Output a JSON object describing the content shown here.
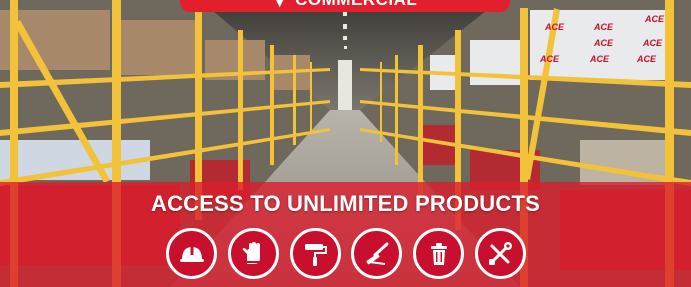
{
  "banner": {
    "text": "COMMERCIAL"
  },
  "headline": "ACCESS TO UNLIMITED PRODUCTS",
  "brand_marks": [
    "ACE",
    "ACE",
    "ACE",
    "ACE",
    "ACE",
    "ACE",
    "ACE",
    "ACE"
  ],
  "categories": [
    {
      "icon": "hard-hat-icon"
    },
    {
      "icon": "work-glove-icon"
    },
    {
      "icon": "paint-roller-icon"
    },
    {
      "icon": "squeegee-icon"
    },
    {
      "icon": "trash-can-icon"
    },
    {
      "icon": "tools-icon"
    }
  ],
  "colors": {
    "accent_red": "#e41f2d",
    "band_red": "#da1e2d",
    "rack_yellow": "#f2c23a",
    "white": "#ffffff"
  }
}
